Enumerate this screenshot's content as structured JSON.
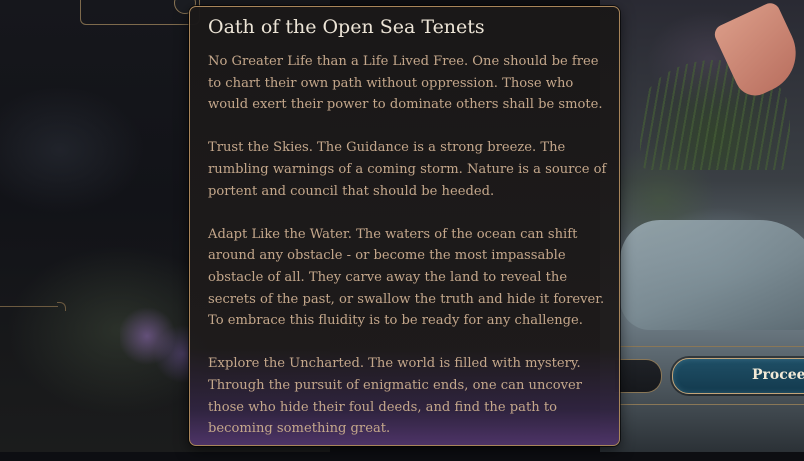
{
  "panel": {
    "title": "Oath of the Open Sea Tenets",
    "tenets": [
      "No Greater Life than a Life Lived Free. One should be free to chart their own path without oppression. Those who would exert their power to dominate others shall be smote.",
      "Trust the Skies. The Guidance is a strong breeze. The rumbling warnings of a coming storm. Nature is a source of portent and council that should be heeded.",
      "Adapt Like the Water. The waters of the ocean can shift around any obstacle - or become the most impassable obstacle of all. They carve away the land to reveal the secrets of the past, or swallow the truth and hide it forever. To embrace this fluidity is to be ready for any challenge.",
      "Explore the Uncharted. The world is filled with mystery. Through the pursuit of enigmatic ends, one can uncover those who hide their foul deeds, and find the path to becoming something great."
    ]
  },
  "actions": {
    "proceed_label": "Proceed"
  },
  "colors": {
    "panel_border": "#a8855a",
    "title_text": "#ece4d6",
    "body_text": "#c4a78b",
    "proceed_fill": "#1f4f66"
  }
}
